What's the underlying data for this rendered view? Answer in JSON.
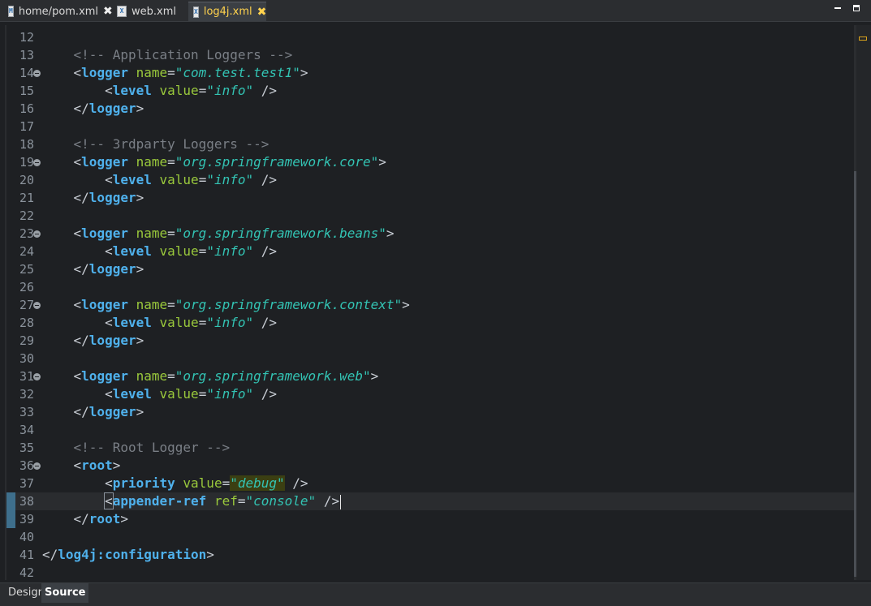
{
  "tabs": [
    {
      "label": "home/pom.xml",
      "icon": "maven-file-icon",
      "glyph": "M",
      "closable": true,
      "active": false
    },
    {
      "label": "web.xml",
      "icon": "xml-file-icon",
      "glyph": "X",
      "closable": false,
      "active": false
    },
    {
      "label": "log4j.xml",
      "icon": "xml-file-icon",
      "glyph": "X",
      "closable": true,
      "active": true
    }
  ],
  "close_glyph": "✖",
  "bottom_tabs": {
    "design": "Design",
    "source": "Source"
  },
  "current_line": "38",
  "lines": [
    {
      "n": "12",
      "fold": false,
      "change": false,
      "tokens": [
        [
          "c-punct",
          "        "
        ]
      ]
    },
    {
      "n": "13",
      "fold": false,
      "change": false,
      "tokens": [
        [
          "c-comment",
          "    <!-- Application Loggers -->"
        ]
      ]
    },
    {
      "n": "14",
      "fold": true,
      "change": false,
      "tokens": [
        [
          "c-punct",
          "    <"
        ],
        [
          "c-tag",
          "logger"
        ],
        [
          "c-punct",
          " "
        ],
        [
          "c-attr",
          "name"
        ],
        [
          "c-eq",
          "="
        ],
        [
          "c-val",
          "\"com.test.test1\""
        ],
        [
          "c-punct",
          ">"
        ]
      ]
    },
    {
      "n": "15",
      "fold": false,
      "change": false,
      "tokens": [
        [
          "c-punct",
          "        <"
        ],
        [
          "c-tag",
          "level"
        ],
        [
          "c-punct",
          " "
        ],
        [
          "c-attr",
          "value"
        ],
        [
          "c-eq",
          "="
        ],
        [
          "c-val",
          "\"info\""
        ],
        [
          "c-punct",
          " />"
        ]
      ]
    },
    {
      "n": "16",
      "fold": false,
      "change": false,
      "tokens": [
        [
          "c-punct",
          "    </"
        ],
        [
          "c-tag",
          "logger"
        ],
        [
          "c-punct",
          ">"
        ]
      ]
    },
    {
      "n": "17",
      "fold": false,
      "change": false,
      "tokens": []
    },
    {
      "n": "18",
      "fold": false,
      "change": false,
      "tokens": [
        [
          "c-comment",
          "    <!-- 3rdparty Loggers -->"
        ]
      ]
    },
    {
      "n": "19",
      "fold": true,
      "change": false,
      "tokens": [
        [
          "c-punct",
          "    <"
        ],
        [
          "c-tag",
          "logger"
        ],
        [
          "c-punct",
          " "
        ],
        [
          "c-attr",
          "name"
        ],
        [
          "c-eq",
          "="
        ],
        [
          "c-val",
          "\"org.springframework.core\""
        ],
        [
          "c-punct",
          ">"
        ]
      ]
    },
    {
      "n": "20",
      "fold": false,
      "change": false,
      "tokens": [
        [
          "c-punct",
          "        <"
        ],
        [
          "c-tag",
          "level"
        ],
        [
          "c-punct",
          " "
        ],
        [
          "c-attr",
          "value"
        ],
        [
          "c-eq",
          "="
        ],
        [
          "c-val",
          "\"info\""
        ],
        [
          "c-punct",
          " />"
        ]
      ]
    },
    {
      "n": "21",
      "fold": false,
      "change": false,
      "tokens": [
        [
          "c-punct",
          "    </"
        ],
        [
          "c-tag",
          "logger"
        ],
        [
          "c-punct",
          ">"
        ]
      ]
    },
    {
      "n": "22",
      "fold": false,
      "change": false,
      "tokens": []
    },
    {
      "n": "23",
      "fold": true,
      "change": false,
      "tokens": [
        [
          "c-punct",
          "    <"
        ],
        [
          "c-tag",
          "logger"
        ],
        [
          "c-punct",
          " "
        ],
        [
          "c-attr",
          "name"
        ],
        [
          "c-eq",
          "="
        ],
        [
          "c-val",
          "\"org.springframework.beans\""
        ],
        [
          "c-punct",
          ">"
        ]
      ]
    },
    {
      "n": "24",
      "fold": false,
      "change": false,
      "tokens": [
        [
          "c-punct",
          "        <"
        ],
        [
          "c-tag",
          "level"
        ],
        [
          "c-punct",
          " "
        ],
        [
          "c-attr",
          "value"
        ],
        [
          "c-eq",
          "="
        ],
        [
          "c-val",
          "\"info\""
        ],
        [
          "c-punct",
          " />"
        ]
      ]
    },
    {
      "n": "25",
      "fold": false,
      "change": false,
      "tokens": [
        [
          "c-punct",
          "    </"
        ],
        [
          "c-tag",
          "logger"
        ],
        [
          "c-punct",
          ">"
        ]
      ]
    },
    {
      "n": "26",
      "fold": false,
      "change": false,
      "tokens": []
    },
    {
      "n": "27",
      "fold": true,
      "change": false,
      "tokens": [
        [
          "c-punct",
          "    <"
        ],
        [
          "c-tag",
          "logger"
        ],
        [
          "c-punct",
          " "
        ],
        [
          "c-attr",
          "name"
        ],
        [
          "c-eq",
          "="
        ],
        [
          "c-val",
          "\"org.springframework.context\""
        ],
        [
          "c-punct",
          ">"
        ]
      ]
    },
    {
      "n": "28",
      "fold": false,
      "change": false,
      "tokens": [
        [
          "c-punct",
          "        <"
        ],
        [
          "c-tag",
          "level"
        ],
        [
          "c-punct",
          " "
        ],
        [
          "c-attr",
          "value"
        ],
        [
          "c-eq",
          "="
        ],
        [
          "c-val",
          "\"info\""
        ],
        [
          "c-punct",
          " />"
        ]
      ]
    },
    {
      "n": "29",
      "fold": false,
      "change": false,
      "tokens": [
        [
          "c-punct",
          "    </"
        ],
        [
          "c-tag",
          "logger"
        ],
        [
          "c-punct",
          ">"
        ]
      ]
    },
    {
      "n": "30",
      "fold": false,
      "change": false,
      "tokens": []
    },
    {
      "n": "31",
      "fold": true,
      "change": false,
      "tokens": [
        [
          "c-punct",
          "    <"
        ],
        [
          "c-tag",
          "logger"
        ],
        [
          "c-punct",
          " "
        ],
        [
          "c-attr",
          "name"
        ],
        [
          "c-eq",
          "="
        ],
        [
          "c-val",
          "\"org.springframework.web\""
        ],
        [
          "c-punct",
          ">"
        ]
      ]
    },
    {
      "n": "32",
      "fold": false,
      "change": false,
      "tokens": [
        [
          "c-punct",
          "        <"
        ],
        [
          "c-tag",
          "level"
        ],
        [
          "c-punct",
          " "
        ],
        [
          "c-attr",
          "value"
        ],
        [
          "c-eq",
          "="
        ],
        [
          "c-val",
          "\"info\""
        ],
        [
          "c-punct",
          " />"
        ]
      ]
    },
    {
      "n": "33",
      "fold": false,
      "change": false,
      "tokens": [
        [
          "c-punct",
          "    </"
        ],
        [
          "c-tag",
          "logger"
        ],
        [
          "c-punct",
          ">"
        ]
      ]
    },
    {
      "n": "34",
      "fold": false,
      "change": false,
      "tokens": []
    },
    {
      "n": "35",
      "fold": false,
      "change": false,
      "tokens": [
        [
          "c-comment",
          "    <!-- Root Logger -->"
        ]
      ]
    },
    {
      "n": "36",
      "fold": true,
      "change": false,
      "tokens": [
        [
          "c-punct",
          "    <"
        ],
        [
          "c-tag",
          "root"
        ],
        [
          "c-punct",
          ">"
        ]
      ]
    },
    {
      "n": "37",
      "fold": false,
      "change": false,
      "tokens": [
        [
          "c-punct",
          "        <"
        ],
        [
          "c-tag",
          "priority"
        ],
        [
          "c-punct",
          " "
        ],
        [
          "c-attr",
          "value"
        ],
        [
          "c-eq",
          "="
        ],
        [
          "c-val-hl",
          "\"debug\""
        ],
        [
          "c-punct",
          " />"
        ]
      ]
    },
    {
      "n": "38",
      "fold": false,
      "change": true,
      "tokens": [
        [
          "c-punct",
          "        "
        ],
        [
          "bracket",
          "<"
        ],
        [
          "c-tag",
          "appender-ref"
        ],
        [
          "c-punct",
          " "
        ],
        [
          "c-attr",
          "ref"
        ],
        [
          "c-eq",
          "="
        ],
        [
          "c-val",
          "\"console\""
        ],
        [
          "c-punct",
          " />"
        ],
        [
          "caret",
          ""
        ]
      ]
    },
    {
      "n": "39",
      "fold": false,
      "change": true,
      "tokens": [
        [
          "c-punct",
          "    </"
        ],
        [
          "c-tag",
          "root"
        ],
        [
          "c-punct",
          ">"
        ]
      ]
    },
    {
      "n": "40",
      "fold": false,
      "change": false,
      "tokens": []
    },
    {
      "n": "41",
      "fold": false,
      "change": false,
      "tokens": [
        [
          "c-punct",
          "</"
        ],
        [
          "c-tag",
          "log4j:configuration"
        ],
        [
          "c-punct",
          ">"
        ]
      ]
    },
    {
      "n": "42",
      "fold": false,
      "change": false,
      "tokens": []
    }
  ]
}
